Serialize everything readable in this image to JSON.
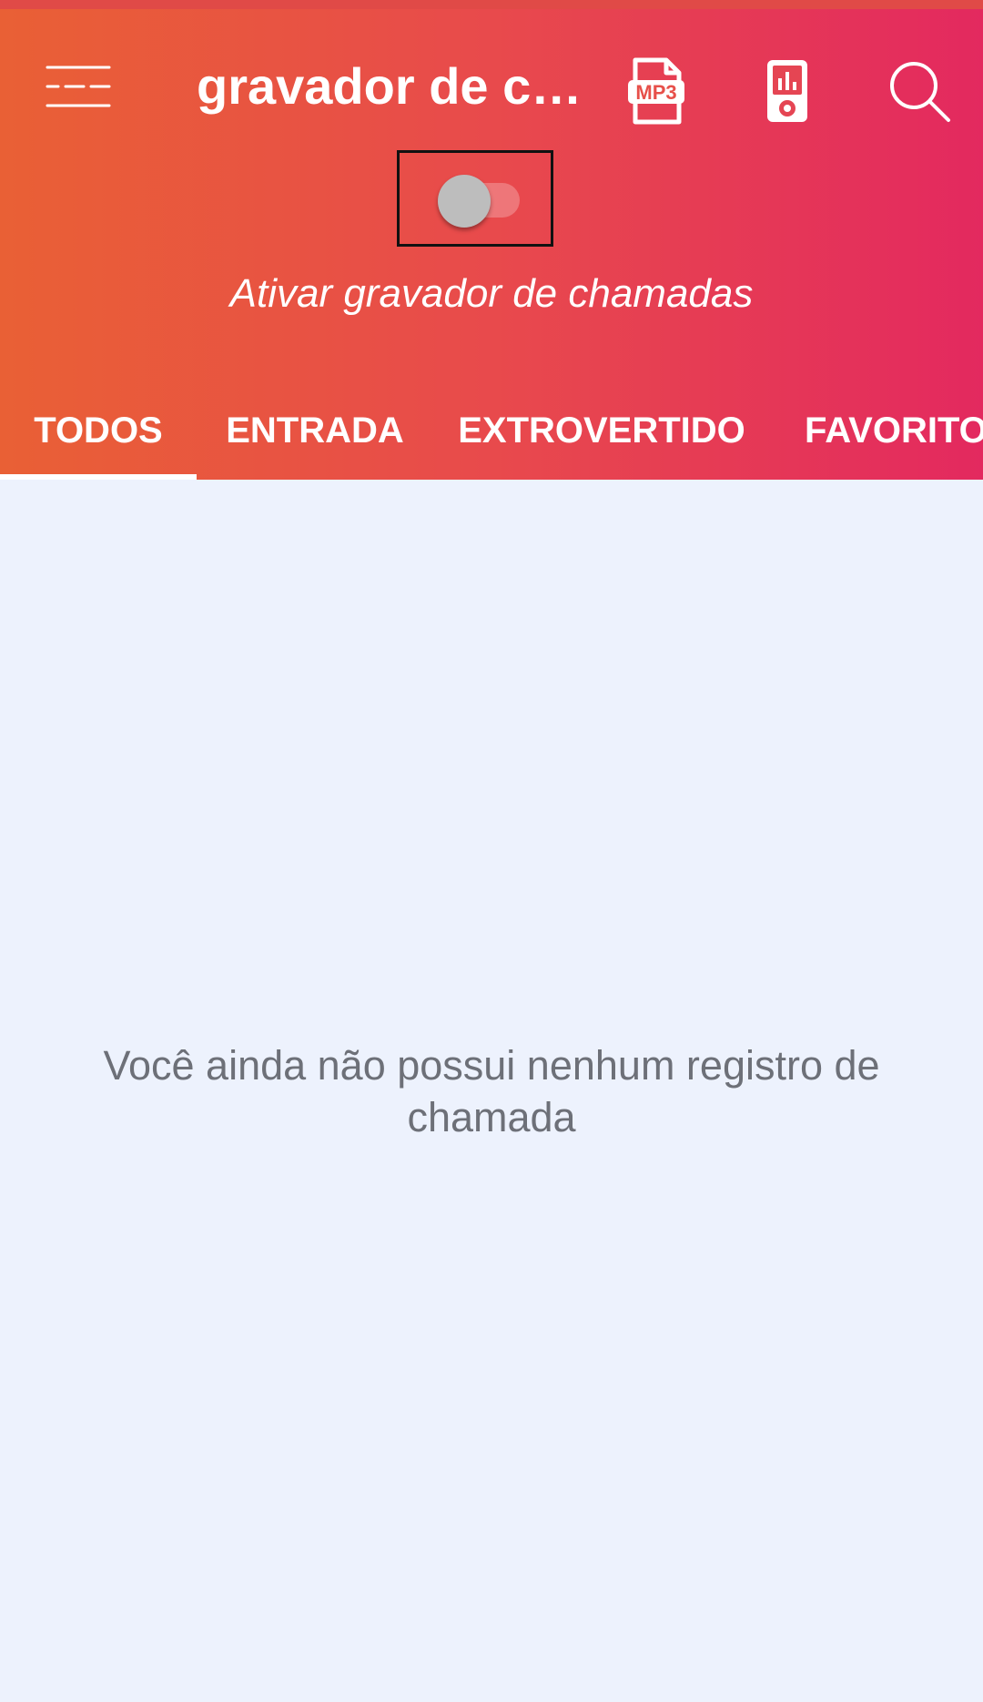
{
  "header": {
    "title": "gravador de c…",
    "menu_icon": "menu-icon",
    "mp3_icon": "mp3-file-icon",
    "mp3_icon_text": "MP3",
    "player_icon": "music-player-icon",
    "search_icon": "search-icon"
  },
  "recorder_toggle": {
    "state": "off",
    "caption": "Ativar gravador de chamadas"
  },
  "tabs": [
    {
      "label": "TODOS",
      "selected": true
    },
    {
      "label": "ENTRADA",
      "selected": false
    },
    {
      "label": "EXTROVERTIDO",
      "selected": false
    },
    {
      "label": "FAVORITO",
      "selected": false
    }
  ],
  "empty_state": {
    "message": "Você ainda não possui nenhum registro de chamada"
  },
  "colors": {
    "header_gradient_start": "#e96035",
    "header_gradient_end": "#e3295f",
    "background": "#edf2fd",
    "empty_text": "#6d7078"
  }
}
